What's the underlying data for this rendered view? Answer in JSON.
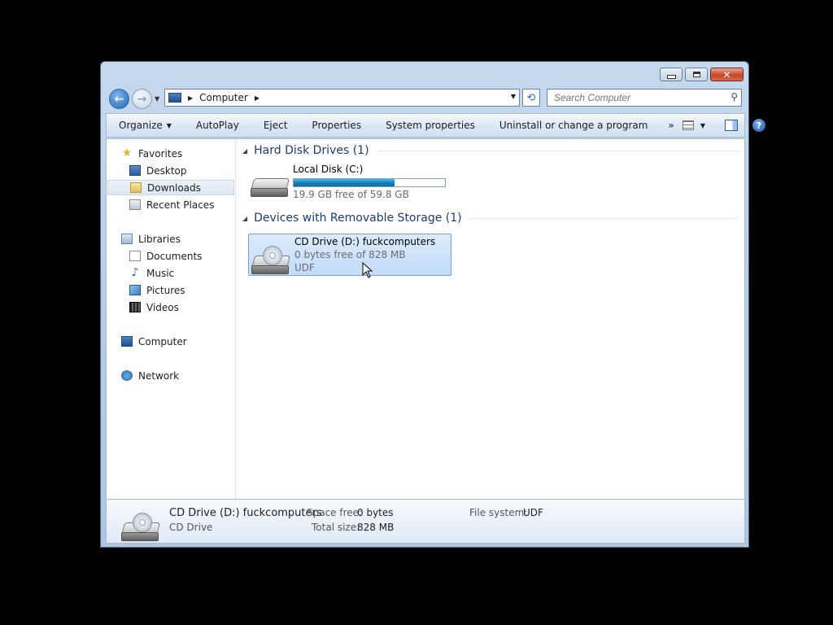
{
  "address": {
    "crumb": "Computer"
  },
  "search": {
    "placeholder": "Search Computer"
  },
  "toolbar": {
    "organize": "Organize",
    "autoplay": "AutoPlay",
    "eject": "Eject",
    "properties": "Properties",
    "system_properties": "System properties",
    "uninstall": "Uninstall or change a program",
    "more": "»"
  },
  "sidebar": {
    "favorites": "Favorites",
    "desktop": "Desktop",
    "downloads": "Downloads",
    "recent": "Recent Places",
    "libraries": "Libraries",
    "documents": "Documents",
    "music": "Music",
    "pictures": "Pictures",
    "videos": "Videos",
    "computer": "Computer",
    "network": "Network"
  },
  "groups": {
    "hdd": "Hard Disk Drives (1)",
    "removable": "Devices with Removable Storage (1)"
  },
  "drives": {
    "local": {
      "name": "Local Disk (C:)",
      "info": "19.9 GB free of 59.8 GB",
      "used_fraction": 0.667
    },
    "cd": {
      "name": "CD Drive (D:) fuckcomputers",
      "info": "0 bytes free of 828 MB",
      "fs": "UDF"
    }
  },
  "details": {
    "name": "CD Drive (D:) fuckcomputers",
    "type": "CD Drive",
    "space_free_label": "Space free:",
    "space_free": "0 bytes",
    "total_size_label": "Total size:",
    "total_size": "828 MB",
    "fs_label": "File system:",
    "fs": "UDF"
  },
  "icons": {
    "back": "back-arrow-icon",
    "forward": "forward-arrow-icon",
    "search": "search-icon",
    "help": "help-icon"
  }
}
